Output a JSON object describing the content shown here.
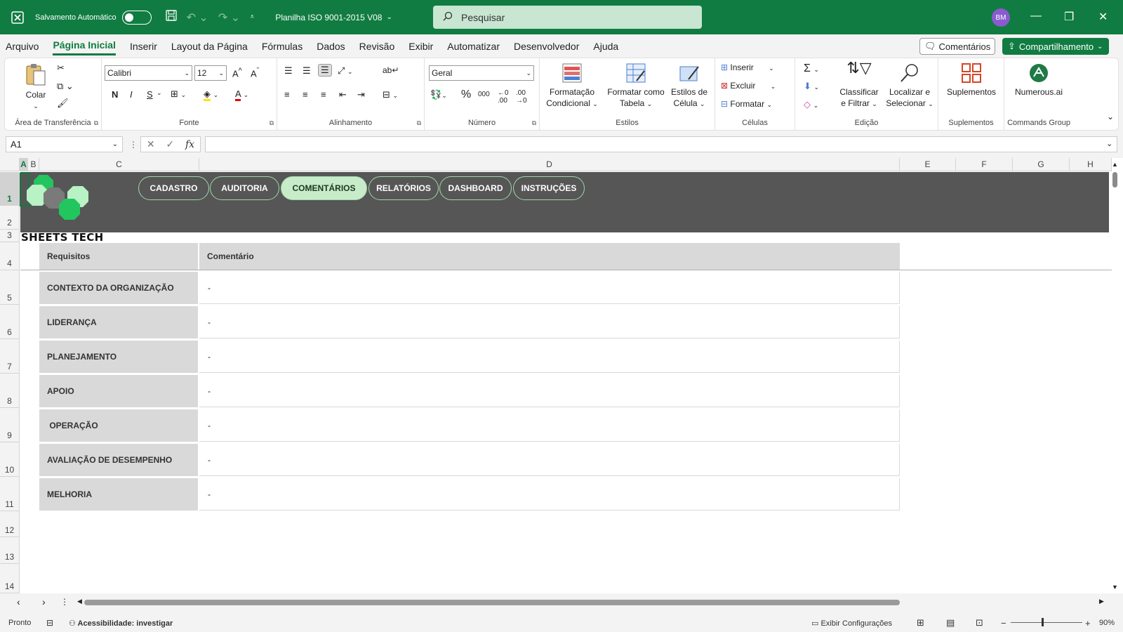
{
  "titlebar": {
    "autosave_label": "Salvamento Automático",
    "filename": "Planilha ISO 9001-2015 V08",
    "search_placeholder": "Pesquisar",
    "avatar_initials": "BM"
  },
  "menu": {
    "items": [
      "Arquivo",
      "Página Inicial",
      "Inserir",
      "Layout da Página",
      "Fórmulas",
      "Dados",
      "Revisão",
      "Exibir",
      "Automatizar",
      "Desenvolvedor",
      "Ajuda"
    ],
    "active_index": 1,
    "comments_label": "Comentários",
    "share_label": "Compartilhamento"
  },
  "ribbon": {
    "clipboard": {
      "paste_label": "Colar",
      "group_label": "Área de Transferência"
    },
    "font": {
      "font_name": "Calibri",
      "font_size": "12",
      "group_label": "Fonte",
      "bold": "N",
      "italic": "I",
      "underline": "S"
    },
    "alignment": {
      "group_label": "Alinhamento"
    },
    "number": {
      "format": "Geral",
      "group_label": "Número"
    },
    "styles": {
      "cond_format": [
        "Formatação",
        "Condicional"
      ],
      "format_table": [
        "Formatar como",
        "Tabela"
      ],
      "cell_styles": [
        "Estilos de",
        "Célula"
      ],
      "group_label": "Estilos"
    },
    "cells": {
      "insert": "Inserir",
      "delete": "Excluir",
      "format": "Formatar",
      "group_label": "Células"
    },
    "editing": {
      "sort": [
        "Classificar",
        "e Filtrar"
      ],
      "find": [
        "Localizar e",
        "Selecionar"
      ],
      "group_label": "Edição"
    },
    "addins": {
      "label": "Suplementos",
      "group_label": "Suplementos"
    },
    "commands": {
      "label": "Numerous.ai",
      "group_label": "Commands Group"
    }
  },
  "formula_bar": {
    "name_box": "A1",
    "fx": "fx",
    "value": ""
  },
  "columns": [
    "A",
    "B",
    "C",
    "D",
    "E",
    "F",
    "G",
    "H"
  ],
  "rows": [
    "1",
    "2",
    "3",
    "4",
    "5",
    "6",
    "7",
    "8",
    "9",
    "10",
    "11",
    "12",
    "13",
    "14"
  ],
  "nav_buttons": [
    "CADASTRO",
    "AUDITORIA",
    "COMENTÁRIOS",
    "RELATÓRIOS",
    "DASHBOARD",
    "INSTRUÇÕES"
  ],
  "nav_active_index": 2,
  "brand": "SHEETS TECH",
  "table": {
    "headers": [
      "Requisitos",
      "Comentário"
    ],
    "rows": [
      {
        "req": "CONTEXTO DA ORGANIZAÇÃO",
        "comment": "-"
      },
      {
        "req": "LIDERANÇA",
        "comment": "-"
      },
      {
        "req": "PLANEJAMENTO",
        "comment": "-"
      },
      {
        "req": "APOIO",
        "comment": "-"
      },
      {
        "req": " OPERAÇÃO",
        "comment": "-"
      },
      {
        "req": "AVALIAÇÃO DE DESEMPENHO",
        "comment": "-"
      },
      {
        "req": "MELHORIA",
        "comment": "-"
      }
    ]
  },
  "statusbar": {
    "ready": "Pronto",
    "accessibility": "Acessibilidade: investigar",
    "display_settings": "Exibir Configurações",
    "zoom": "90%"
  },
  "colors": {
    "brand_green": "#107c41",
    "banner_gray": "#565656",
    "nav_border": "#a0d6a8",
    "nav_active": "#c8ecc9"
  }
}
